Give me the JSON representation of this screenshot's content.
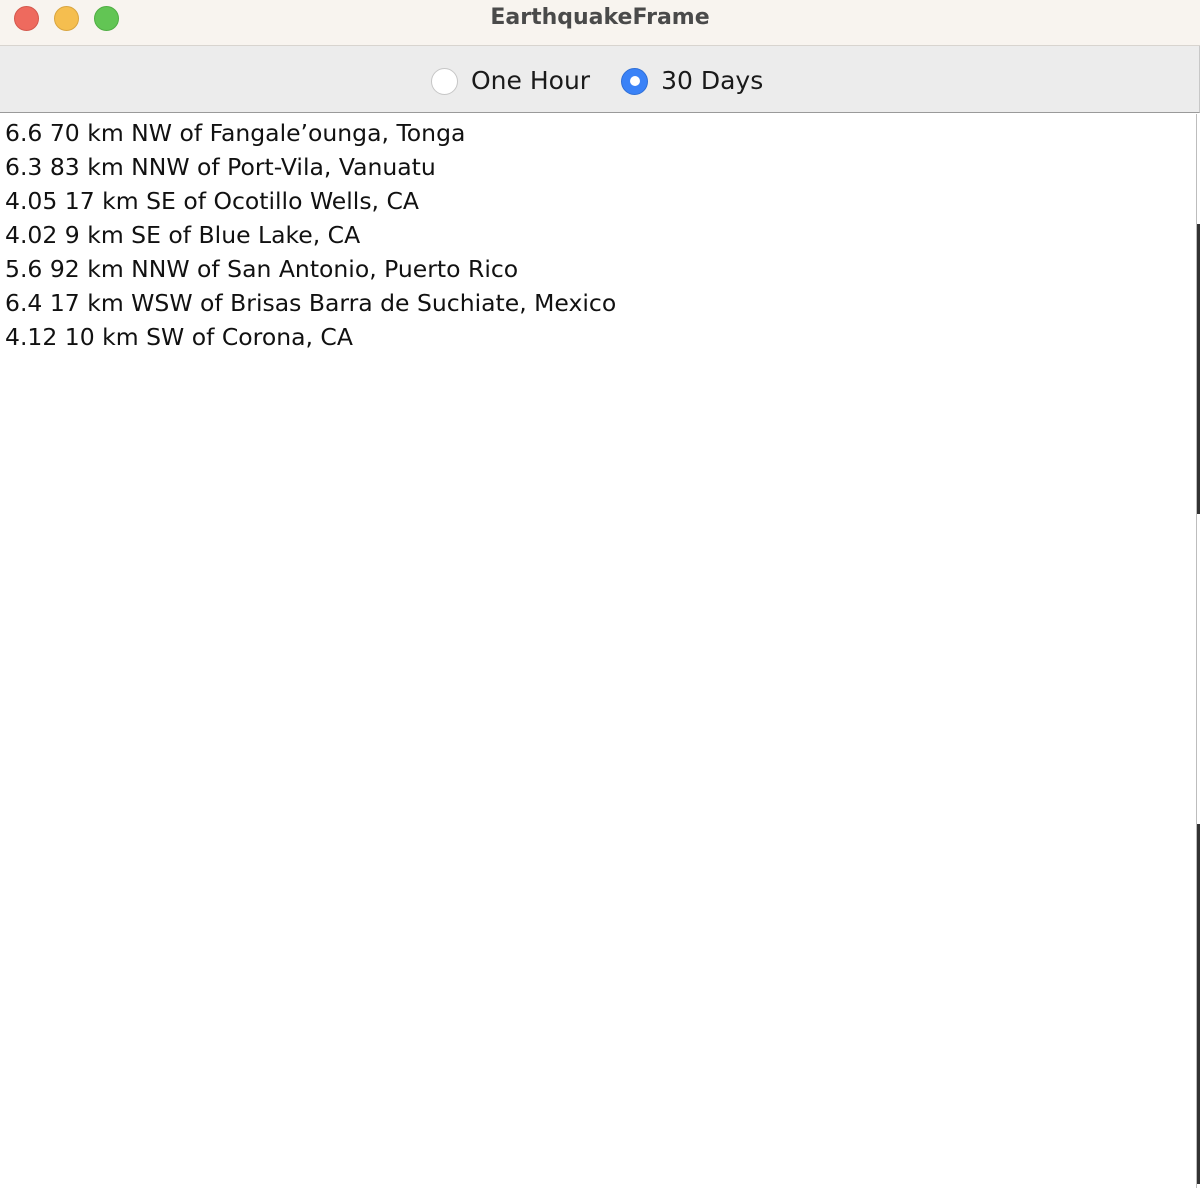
{
  "window": {
    "title": "EarthquakeFrame"
  },
  "toolbar": {
    "options": [
      {
        "label": "One Hour",
        "selected": false
      },
      {
        "label": "30 Days",
        "selected": true
      }
    ]
  },
  "earthquakes": [
    "6.6 70 km NW of Fangale’ounga, Tonga",
    "6.3 83 km NNW of Port-Vila, Vanuatu",
    "4.05 17 km SE of Ocotillo Wells, CA",
    "4.02 9 km SE of Blue Lake, CA",
    "5.6 92 km NNW of San Antonio, Puerto Rico",
    "6.4 17 km WSW of Brisas Barra de Suchiate, Mexico",
    "4.12 10 km SW of Corona, CA"
  ],
  "colors": {
    "accent": "#3a82f7",
    "close": "#ee6a5e",
    "minimize": "#f5be4f",
    "zoom": "#62c554"
  }
}
